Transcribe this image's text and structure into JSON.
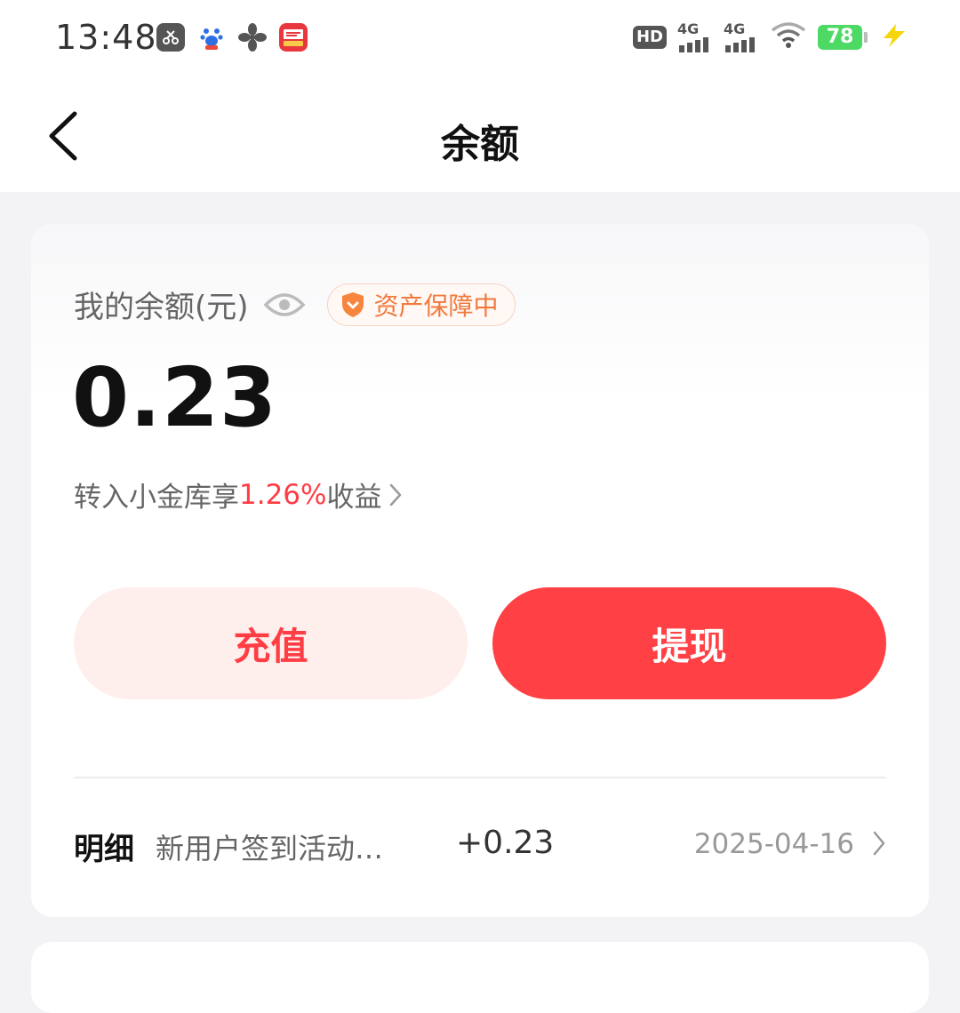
{
  "status_bar": {
    "time": "13:48",
    "notification_icons": [
      "scissors-app-icon",
      "baidu-app-icon",
      "fan-app-icon",
      "toutiao-app-icon"
    ],
    "hd_label": "HD",
    "network_1": "4G",
    "network_2": "4G",
    "battery_level": "78"
  },
  "nav": {
    "title": "余额"
  },
  "balance": {
    "label": "我的余额(元)",
    "guarantee_badge": "资产保障中",
    "amount": "0.23",
    "promo_prefix": "转入小金库享",
    "promo_rate": "1.26%",
    "promo_suffix": "收益"
  },
  "actions": {
    "recharge_label": "充值",
    "withdraw_label": "提现"
  },
  "detail": {
    "label": "明细",
    "description": "新用户签到活动…",
    "amount": "+0.23",
    "date": "2025-04-16"
  },
  "colors": {
    "accent_red": "#ff4044",
    "recharge_bg": "#feeeec",
    "guarantee_orange": "#f07a3e"
  }
}
